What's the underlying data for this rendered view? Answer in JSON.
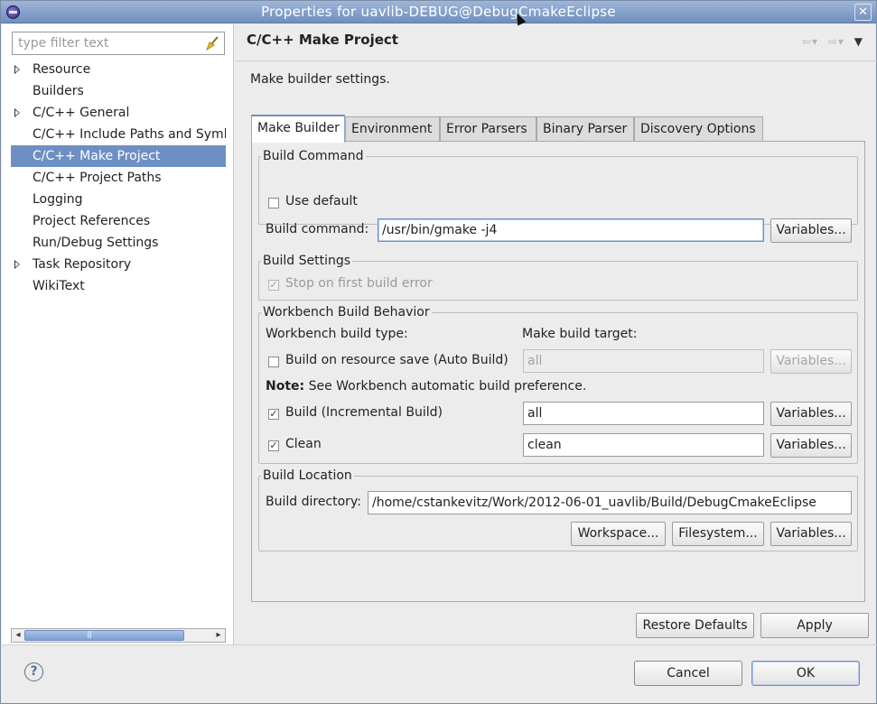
{
  "window": {
    "title": "Properties for uavlib-DEBUG@DebugCmakeEclipse",
    "close_glyph": "✕"
  },
  "filter": {
    "placeholder": "type filter text"
  },
  "tree": {
    "items": [
      {
        "label": "Resource",
        "expandable": true
      },
      {
        "label": "Builders",
        "expandable": false
      },
      {
        "label": "C/C++ General",
        "expandable": true
      },
      {
        "label": "C/C++ Include Paths and Symbols",
        "expandable": false
      },
      {
        "label": "C/C++ Make Project",
        "expandable": false,
        "selected": true
      },
      {
        "label": "C/C++ Project Paths",
        "expandable": false
      },
      {
        "label": "Logging",
        "expandable": false
      },
      {
        "label": "Project References",
        "expandable": false
      },
      {
        "label": "Run/Debug Settings",
        "expandable": false
      },
      {
        "label": "Task Repository",
        "expandable": true
      },
      {
        "label": "WikiText",
        "expandable": false
      }
    ]
  },
  "page": {
    "title": "C/C++ Make Project",
    "description": "Make builder settings.",
    "nav": {
      "back": "⇦",
      "back_menu": "▾",
      "forward": "⇨",
      "forward_menu": "▾",
      "view_menu": "▼"
    }
  },
  "tabs": [
    "Make Builder",
    "Environment",
    "Error Parsers",
    "Binary Parser",
    "Discovery Options"
  ],
  "build_command": {
    "group": "Build Command",
    "use_default_label": "Use default",
    "use_default_checked": false,
    "command_label": "Build command:",
    "command_value": "/usr/bin/gmake -j4",
    "variables_label": "Variables..."
  },
  "build_settings": {
    "group": "Build Settings",
    "stop_on_error_label": "Stop on first build error",
    "stop_on_error_checked": true
  },
  "workbench": {
    "group": "Workbench Build Behavior",
    "type_label": "Workbench build type:",
    "target_label": "Make build target:",
    "auto_build_label": "Build on resource save (Auto Build)",
    "auto_build_checked": false,
    "auto_build_target": "all",
    "note_bold": "Note:",
    "note_text": "See Workbench automatic build preference.",
    "incremental_label": "Build (Incremental Build)",
    "incremental_checked": true,
    "incremental_target": "all",
    "clean_label": "Clean",
    "clean_checked": true,
    "clean_target": "clean",
    "variables_label": "Variables..."
  },
  "build_location": {
    "group": "Build Location",
    "dir_label": "Build directory:",
    "dir_value": "/home/cstankevitz/Work/2012-06-01_uavlib/Build/DebugCmakeEclipse",
    "workspace_label": "Workspace...",
    "filesystem_label": "Filesystem...",
    "variables_label": "Variables..."
  },
  "actions": {
    "restore_defaults": "Restore Defaults",
    "apply": "Apply"
  },
  "dialog": {
    "help_glyph": "?",
    "cancel": "Cancel",
    "ok": "OK"
  },
  "check_glyph": "✓"
}
